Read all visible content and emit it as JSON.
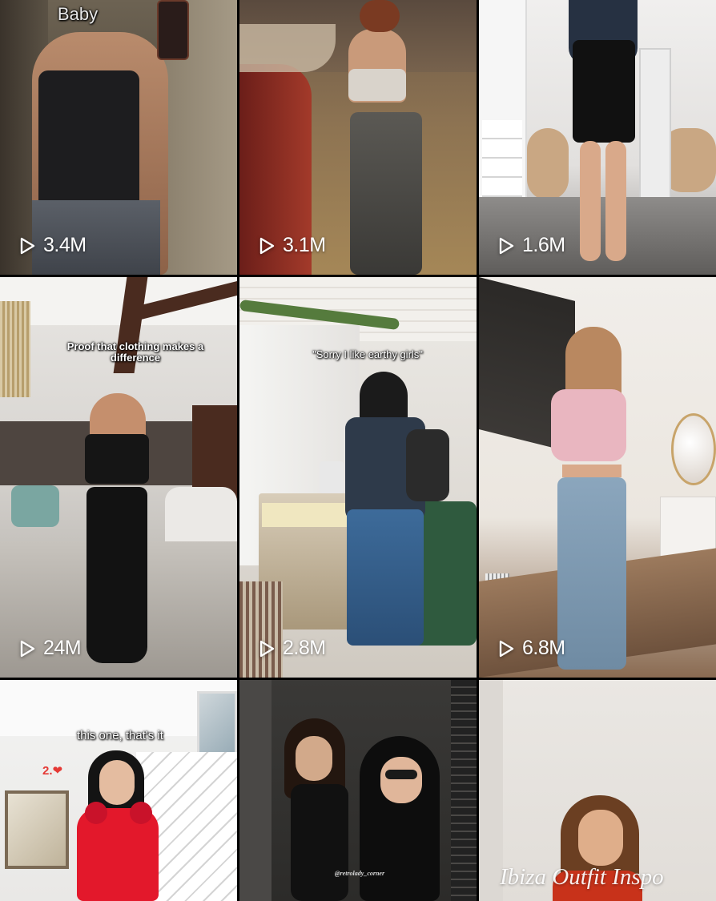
{
  "tiles": [
    {
      "views": "3.4M",
      "caption": "Baby"
    },
    {
      "views": "3.1M"
    },
    {
      "views": "1.6M"
    },
    {
      "views": "24M",
      "caption": "Proof that clothing makes a difference"
    },
    {
      "views": "2.8M",
      "caption": "\"Sorry I like earthy girls\""
    },
    {
      "views": "6.8M"
    },
    {
      "caption": "this one, that's it",
      "rank": "2.❤"
    },
    {
      "watermark": "@retrolady_corner"
    },
    {
      "caption": "Ibiza Outfit Inspo"
    }
  ],
  "icons": {
    "views": "play-outline-icon"
  },
  "colors": {
    "text": "#ffffff",
    "background": "#000000",
    "heart": "#e53935"
  }
}
